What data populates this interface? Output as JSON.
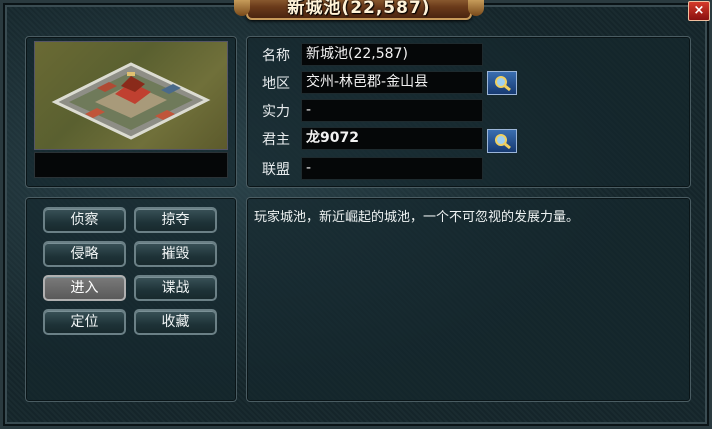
{
  "window": {
    "title": "新城池(22,587)",
    "close_label": "×"
  },
  "info": {
    "name_label": "名称",
    "name_value": "新城池(22,587)",
    "region_label": "地区",
    "region_value": "交州-林邑郡-金山县",
    "power_label": "实力",
    "power_value": "-",
    "lord_label": "君主",
    "lord_value": "龙9072",
    "alliance_label": "联盟",
    "alliance_value": "-"
  },
  "actions": {
    "scout": "侦察",
    "plunder": "掠夺",
    "invade": "侵略",
    "destroy": "摧毁",
    "enter": "进入",
    "espionage": "谍战",
    "locate": "定位",
    "favorite": "收藏"
  },
  "description": "玩家城池，新近崛起的城池，一个不可忽视的发展力量。",
  "icons": {
    "search": "magnifier-icon",
    "city": "city-fortress-icon"
  },
  "colors": {
    "accent_gold": "#c89a5a",
    "title_plate": "#6a3a1a",
    "search_button": "#2a5898"
  }
}
